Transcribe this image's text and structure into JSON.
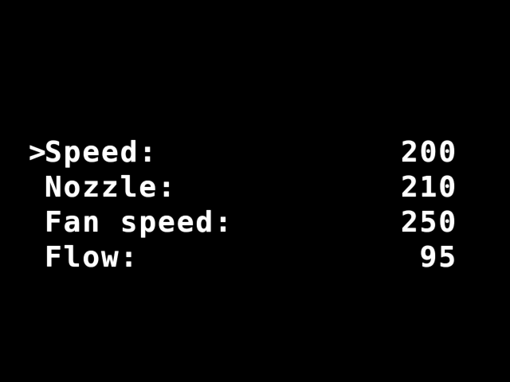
{
  "menu": {
    "cursor": ">",
    "items": [
      {
        "label": "Speed:",
        "value": "200"
      },
      {
        "label": "Nozzle:",
        "value": "210"
      },
      {
        "label": "Fan speed:",
        "value": "250"
      },
      {
        "label": "Flow:",
        "value": "95"
      }
    ]
  },
  "colors": {
    "background": "#000000",
    "text": "#ffffff"
  }
}
